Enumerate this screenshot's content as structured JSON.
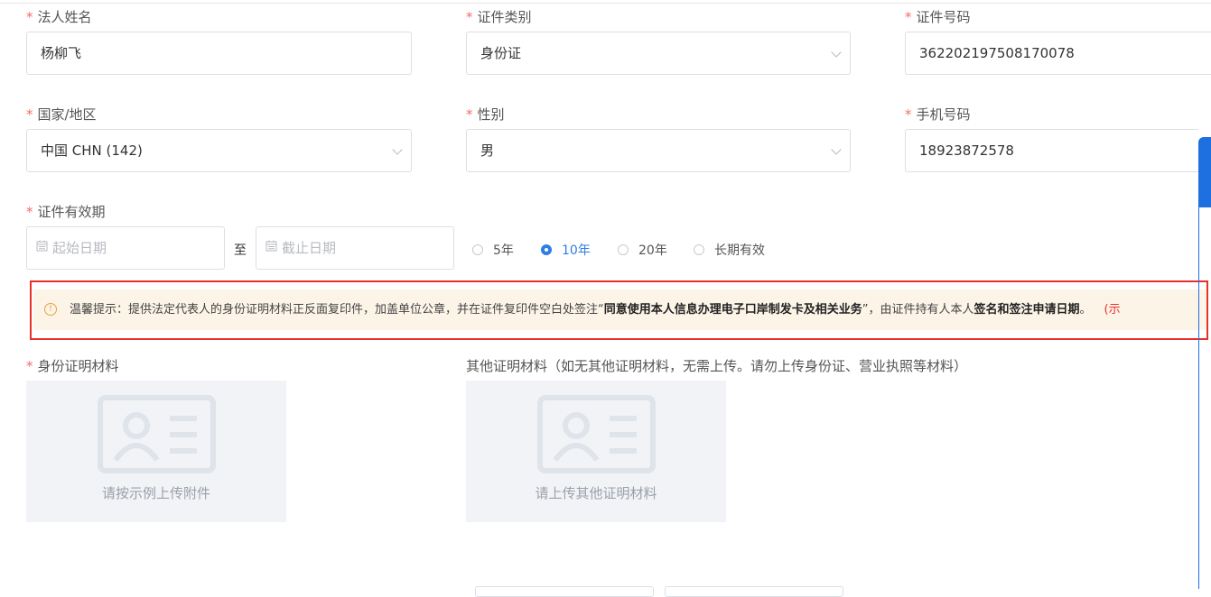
{
  "form": {
    "legal_name": {
      "label": "法人姓名",
      "value": "杨柳飞"
    },
    "id_type": {
      "label": "证件类别",
      "value": "身份证"
    },
    "id_number": {
      "label": "证件号码",
      "value": "362202197508170078"
    },
    "country": {
      "label": "国家/地区",
      "value": "中国 CHN (142)"
    },
    "gender": {
      "label": "性别",
      "value": "男"
    },
    "phone": {
      "label": "手机号码",
      "value": "18923872578"
    },
    "validity": {
      "label": "证件有效期",
      "start_placeholder": "起始日期",
      "separator": "至",
      "end_placeholder": "截止日期",
      "options": [
        "5年",
        "10年",
        "20年",
        "长期有效"
      ],
      "selected": "10年"
    }
  },
  "tip": {
    "prefix": "温馨提示：提供法定代表人的身份证明材料正反面复印件，加盖单位公章，并在证件复印件空白处签注“",
    "bold1": "同意使用本人信息办理电子口岸制发卡及相关业务",
    "middle": "”，由证件持有人本人",
    "bold2": "签名和签注申请日期",
    "suffix": "。",
    "red": "(示"
  },
  "uploads": {
    "id_material": {
      "label": "身份证明材料",
      "caption": "请按示例上传附件"
    },
    "other_material": {
      "label": "其他证明材料（如无其他证明材料，无需上传。请勿上传身份证、营业执照等材料）",
      "caption": "请上传其他证明材料"
    }
  },
  "icons": {
    "calendar": "calendar-icon",
    "warning": "info-circle-icon",
    "id_card": "id-card-icon",
    "dropdown": "chevron-down-icon"
  },
  "colors": {
    "required": "#f56c6c",
    "primary": "#2f7fe0",
    "tip_bg": "#fdf4e8",
    "highlight_border": "#e8302a"
  }
}
